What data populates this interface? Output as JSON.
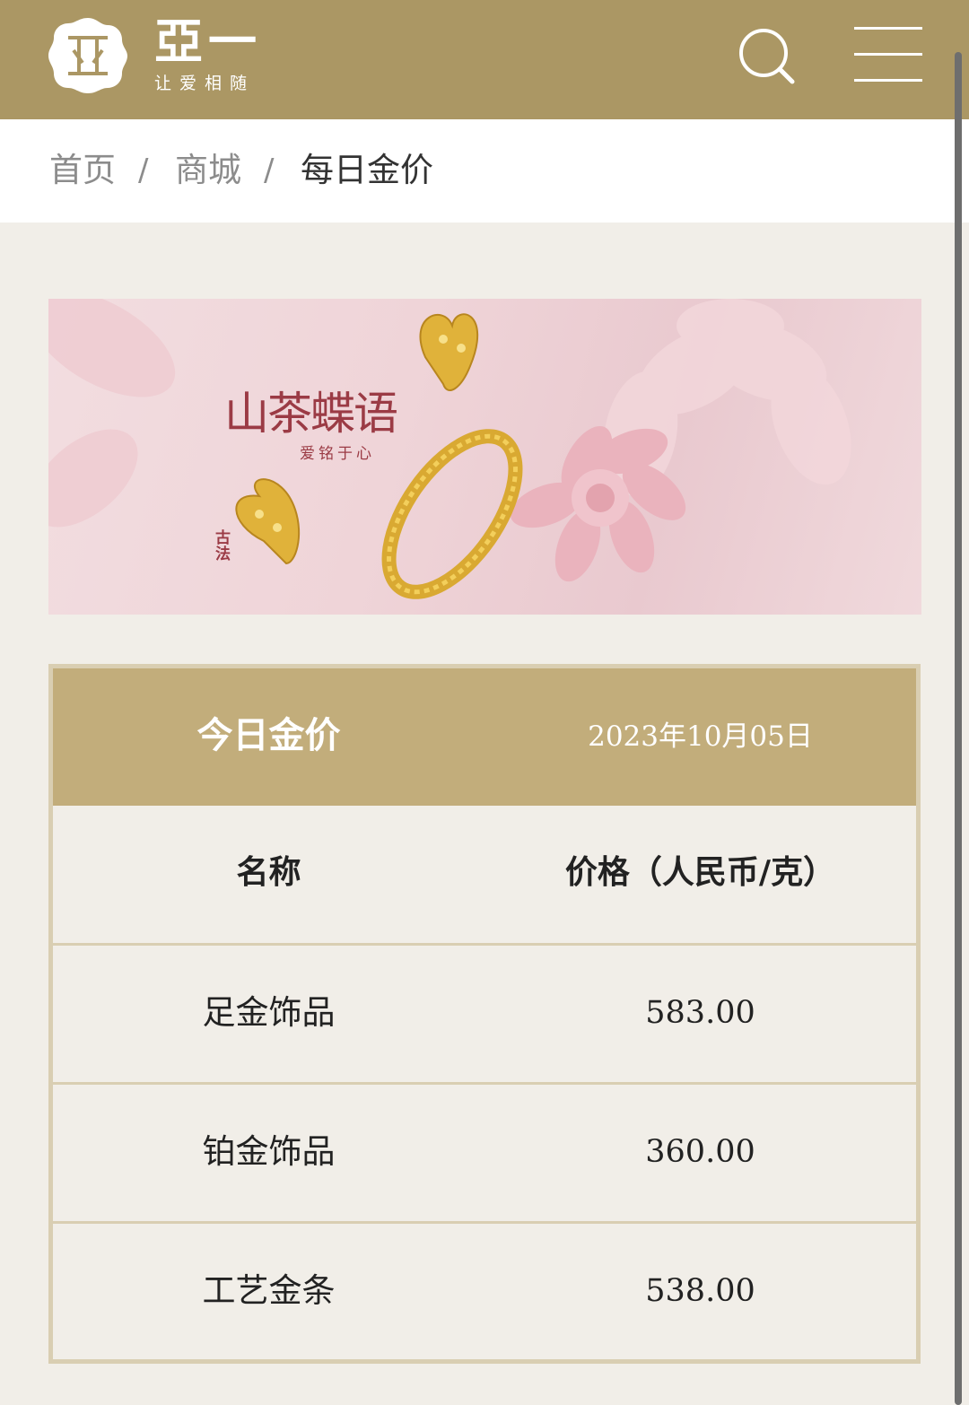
{
  "header": {
    "logo_text": "亞一",
    "slogan": "让爱相随",
    "search_icon": "search-icon",
    "menu_icon": "hamburger-menu-icon",
    "brand_color": "#ab9764"
  },
  "breadcrumb": {
    "items": [
      "首页",
      "商城",
      "每日金价"
    ],
    "separator": "/"
  },
  "banner": {
    "title": "山茶蝶语",
    "subtitle": "爱铭于心",
    "seal": "古法"
  },
  "price_table": {
    "title": "今日金价",
    "date": "2023年10月05日",
    "columns": [
      "名称",
      "价格（人民币/克）"
    ],
    "rows": [
      {
        "name": "足金饰品",
        "price": "583.00"
      },
      {
        "name": "铂金饰品",
        "price": "360.00"
      },
      {
        "name": "工艺金条",
        "price": "538.00"
      }
    ],
    "header_color": "#c2ad7b"
  }
}
